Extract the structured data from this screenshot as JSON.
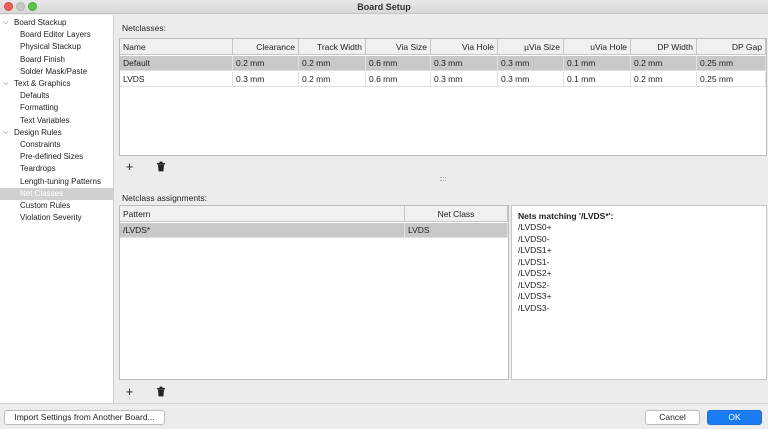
{
  "window": {
    "title": "Board Setup"
  },
  "sidebar": {
    "items": [
      {
        "label": "Board Stackup",
        "level": 0,
        "expanded": true
      },
      {
        "label": "Board Editor Layers",
        "level": 1
      },
      {
        "label": "Physical Stackup",
        "level": 1
      },
      {
        "label": "Board Finish",
        "level": 1
      },
      {
        "label": "Solder Mask/Paste",
        "level": 1
      },
      {
        "label": "Text & Graphics",
        "level": 0,
        "expanded": true
      },
      {
        "label": "Defaults",
        "level": 1
      },
      {
        "label": "Formatting",
        "level": 1
      },
      {
        "label": "Text Variables",
        "level": 1
      },
      {
        "label": "Design Rules",
        "level": 0,
        "expanded": true
      },
      {
        "label": "Constraints",
        "level": 1
      },
      {
        "label": "Pre-defined Sizes",
        "level": 1
      },
      {
        "label": "Teardrops",
        "level": 1
      },
      {
        "label": "Length-tuning Patterns",
        "level": 1
      },
      {
        "label": "Net Classes",
        "level": 1,
        "selected": true
      },
      {
        "label": "Custom Rules",
        "level": 1
      },
      {
        "label": "Violation Severity",
        "level": 1
      }
    ]
  },
  "netclasses": {
    "label": "Netclasses:",
    "columns": [
      "Name",
      "Clearance",
      "Track Width",
      "Via Size",
      "Via Hole",
      "µVia Size",
      "uVia Hole",
      "DP Width",
      "DP Gap"
    ],
    "rows": [
      [
        "Default",
        "0.2 mm",
        "0.2 mm",
        "0.6 mm",
        "0.3 mm",
        "0.3 mm",
        "0.1 mm",
        "0.2 mm",
        "0.25 mm"
      ],
      [
        "LVDS",
        "0.3 mm",
        "0.2 mm",
        "0.6 mm",
        "0.3 mm",
        "0.3 mm",
        "0.1 mm",
        "0.2 mm",
        "0.25 mm"
      ]
    ],
    "selected_row": 0
  },
  "assignments": {
    "label": "Netclass assignments:",
    "columns": [
      "Pattern",
      "Net Class"
    ],
    "rows": [
      [
        "/LVDS*",
        "LVDS"
      ]
    ],
    "selected_row": 0
  },
  "nets_matching": {
    "title": "Nets matching '/LVDS*':",
    "nets": [
      "/LVDS0+",
      "/LVDS0-",
      "/LVDS1+",
      "/LVDS1-",
      "/LVDS2+",
      "/LVDS2-",
      "/LVDS3+",
      "/LVDS3-"
    ]
  },
  "toolbar": {
    "add_glyph": "+",
    "delete_glyph": "🗑"
  },
  "footer": {
    "import_label": "Import Settings from Another Board...",
    "cancel_label": "Cancel",
    "ok_label": "OK"
  },
  "icons": {
    "add": "plus-icon",
    "delete": "trash-icon",
    "tree_toggle": "chevron-down-icon"
  },
  "colors": {
    "accent": "#1a7cf0",
    "selection": "#c8c8c8"
  }
}
